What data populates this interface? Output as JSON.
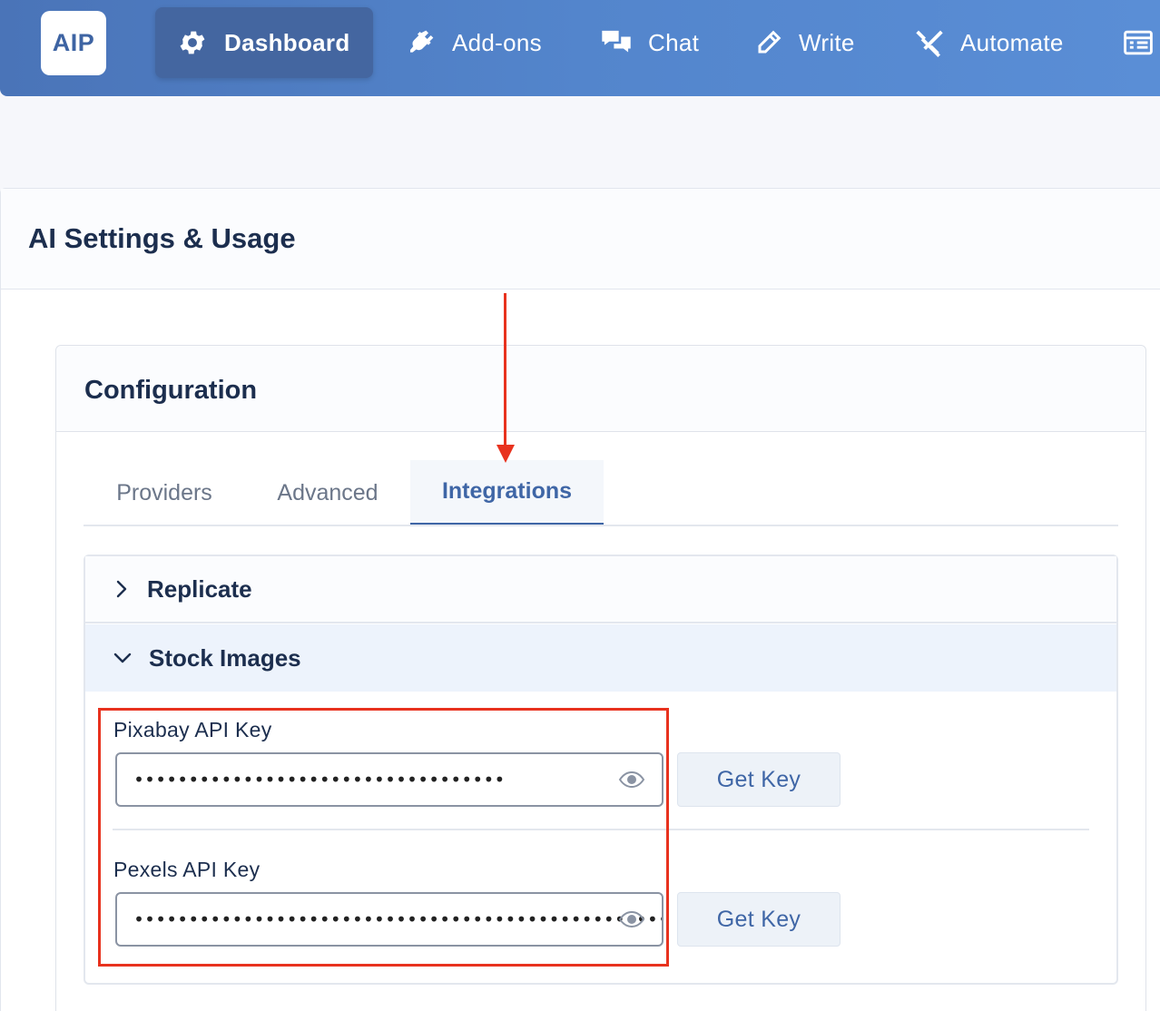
{
  "logo": {
    "text": "AIP"
  },
  "nav": {
    "items": [
      {
        "label": "Dashboard",
        "icon": "gear-icon",
        "active": true
      },
      {
        "label": "Add-ons",
        "icon": "plug-icon",
        "active": false
      },
      {
        "label": "Chat",
        "icon": "chat-bubbles-icon",
        "active": false
      },
      {
        "label": "Write",
        "icon": "pencil-icon",
        "active": false
      },
      {
        "label": "Automate",
        "icon": "crossed-tools-icon",
        "active": false
      },
      {
        "label": "",
        "icon": "list-window-icon",
        "active": false
      }
    ]
  },
  "page": {
    "title": "AI Settings & Usage"
  },
  "configuration": {
    "title": "Configuration",
    "tabs": [
      {
        "label": "Providers",
        "active": false
      },
      {
        "label": "Advanced",
        "active": false
      },
      {
        "label": "Integrations",
        "active": true
      }
    ],
    "accordion": {
      "sections": [
        {
          "label": "Replicate",
          "expanded": false
        },
        {
          "label": "Stock Images",
          "expanded": true
        }
      ],
      "fields": [
        {
          "label": "Pixabay API Key",
          "value": "••••••••••••••••••••••••••••••••••",
          "button_label": "Get Key"
        },
        {
          "label": "Pexels API Key",
          "value": "••••••••••••••••••••••••••••••••••••••••••••••••••",
          "button_label": "Get Key"
        }
      ]
    }
  },
  "colors": {
    "nav_bg": "#5385cc",
    "accent": "#3f66a6",
    "annotation_red": "#e8321e"
  }
}
